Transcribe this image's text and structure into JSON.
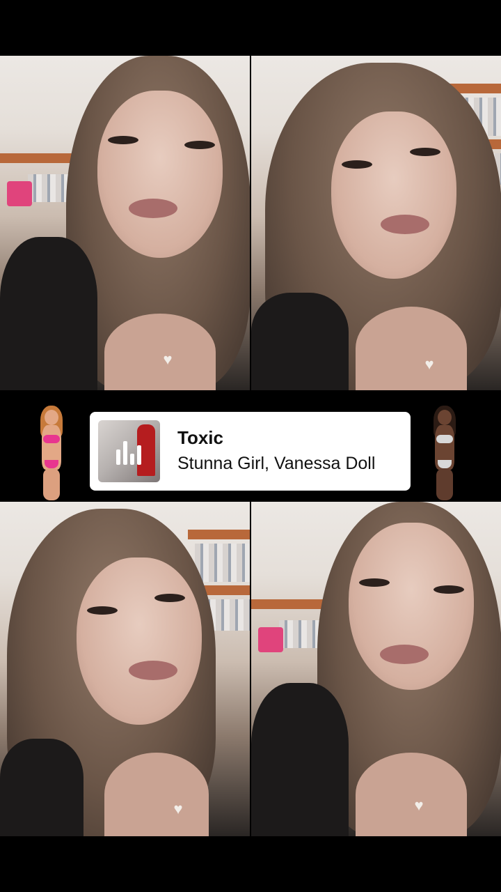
{
  "music_card": {
    "title": "Toxic",
    "artist": "Stunna Girl, Vanessa Doll",
    "icon": "music-bars-icon"
  },
  "colors": {
    "background": "#000000",
    "card": "#ffffff",
    "text": "#111111",
    "sticker_left_swimsuit": "#e8368f",
    "sticker_right_swimsuit": "#d8d8d8"
  },
  "stickers": [
    {
      "name": "sticker-left"
    },
    {
      "name": "sticker-right"
    }
  ]
}
